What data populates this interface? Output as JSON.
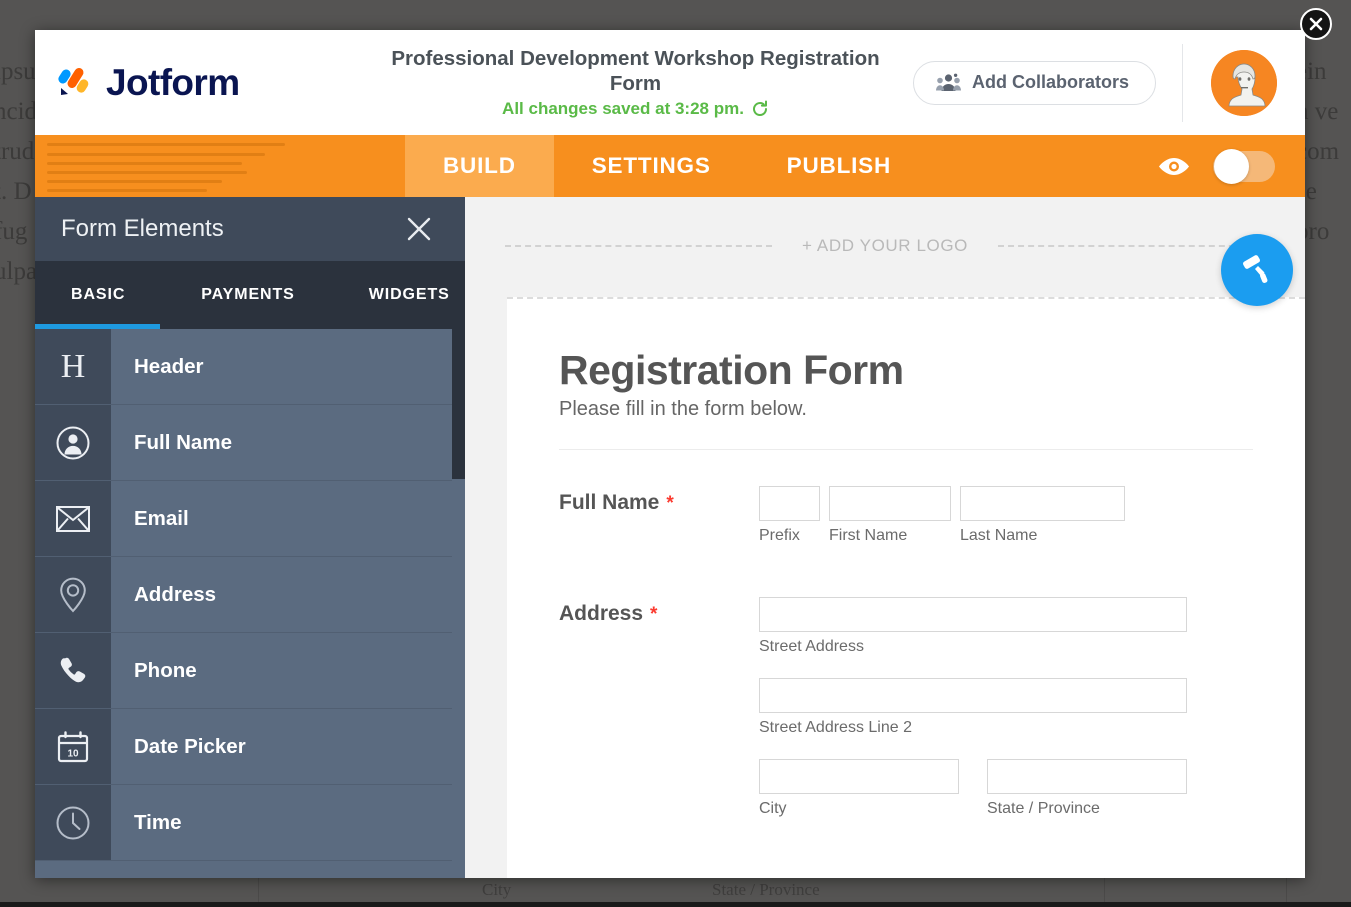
{
  "background": {
    "left_lines": [
      "ipsu",
      "ncid",
      "trud",
      "t. D",
      "fug",
      "ulpa"
    ],
    "right_lines": [
      "ein",
      "n ve",
      "com",
      "se",
      "pro"
    ],
    "bottom_labels": [
      "City",
      "State / Province"
    ]
  },
  "modal": {
    "close_icon": "close-circle-icon"
  },
  "topbar": {
    "brand_name": "Jotform",
    "brand_icon": "jotform-logo-icon",
    "form_title": "Professional Development Workshop Registration Form",
    "save_status": "All changes saved at 3:28 pm.",
    "refresh_icon": "refresh-icon",
    "collaborators_label": "Add Collaborators",
    "collaborators_icon": "people-group-icon",
    "avatar_icon": "user-avatar",
    "avatar_bg": "#f68622"
  },
  "navbar": {
    "tabs": [
      {
        "label": "BUILD",
        "active": true
      },
      {
        "label": "SETTINGS",
        "active": false
      },
      {
        "label": "PUBLISH",
        "active": false
      }
    ],
    "preview_icon": "eye-icon",
    "toggle_state": "off",
    "bg_color": "#f78f1e",
    "active_tab_color": "#fbab4e"
  },
  "elements_panel": {
    "title": "Form Elements",
    "close_icon": "close-icon",
    "tabs": [
      {
        "label": "BASIC",
        "active": true
      },
      {
        "label": "PAYMENTS",
        "active": false
      },
      {
        "label": "WIDGETS",
        "active": false
      }
    ],
    "active_tab_color": "#1e9ae0",
    "items": [
      {
        "label": "Header",
        "icon": "header-h-icon"
      },
      {
        "label": "Full Name",
        "icon": "user-circle-icon"
      },
      {
        "label": "Email",
        "icon": "envelope-icon"
      },
      {
        "label": "Address",
        "icon": "location-pin-icon"
      },
      {
        "label": "Phone",
        "icon": "phone-handset-icon"
      },
      {
        "label": "Date Picker",
        "icon": "calendar-icon",
        "icon_text": "10"
      },
      {
        "label": "Time",
        "icon": "clock-icon"
      }
    ]
  },
  "canvas": {
    "add_logo_label": "+ ADD YOUR LOGO",
    "paint_button_icon": "paint-roller-icon",
    "paint_button_color": "#1b9df0",
    "form": {
      "heading": "Registration Form",
      "subheading": "Please fill in the form below.",
      "fields": [
        {
          "label": "Full Name",
          "required": true,
          "subfields": [
            {
              "sub_label": "Prefix",
              "value": ""
            },
            {
              "sub_label": "First Name",
              "value": ""
            },
            {
              "sub_label": "Last Name",
              "value": ""
            }
          ]
        },
        {
          "label": "Address",
          "required": true,
          "subfields": [
            {
              "sub_label": "Street Address",
              "value": ""
            },
            {
              "sub_label": "Street Address Line 2",
              "value": ""
            },
            {
              "sub_label": "City",
              "value": ""
            },
            {
              "sub_label": "State / Province",
              "value": ""
            }
          ]
        }
      ]
    }
  }
}
